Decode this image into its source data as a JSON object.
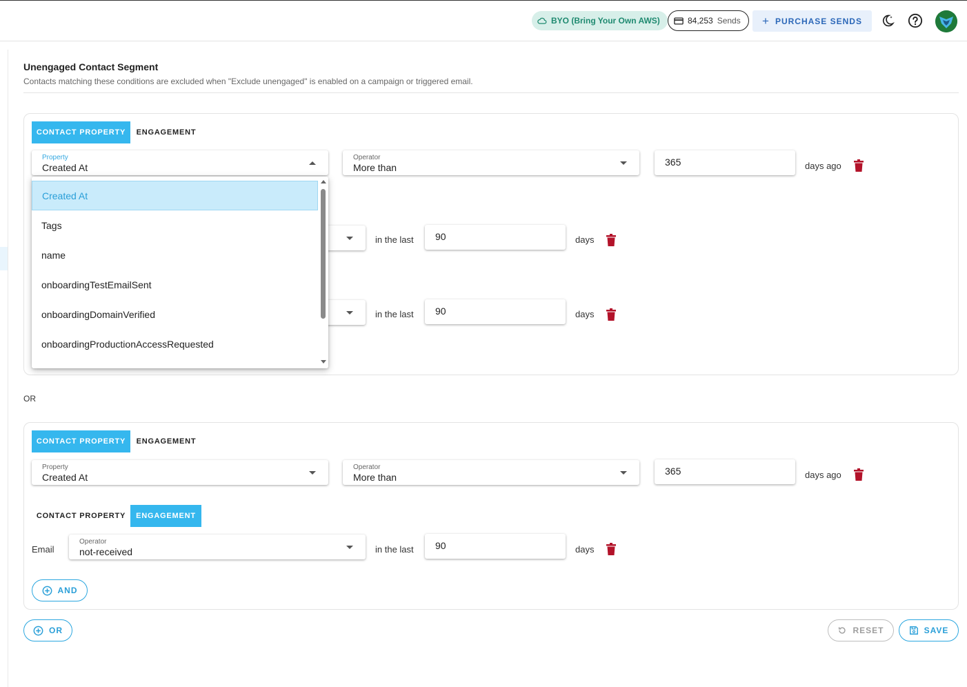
{
  "topbar": {
    "byo_label": "BYO (Bring Your Own AWS)",
    "sends_count": "84,253",
    "sends_label": "Sends",
    "purchase_label": "PURCHASE SENDS"
  },
  "header": {
    "title": "Unengaged Contact Segment",
    "subtitle": "Contacts matching these conditions are excluded when \"Exclude unengaged\" is enabled on a campaign or triggered email."
  },
  "tabs": {
    "contact_property": "CONTACT PROPERTY",
    "engagement": "ENGAGEMENT"
  },
  "group1": {
    "row1": {
      "property_label": "Property",
      "property_value": "Created At",
      "operator_label": "Operator",
      "operator_value": "More than",
      "number": "365",
      "suffix": "days ago"
    },
    "row2": {
      "connector": "in the last",
      "number": "90",
      "suffix": "days"
    },
    "row3": {
      "connector": "in the last",
      "number": "90",
      "suffix": "days"
    }
  },
  "or_label": "OR",
  "group2": {
    "row1": {
      "property_label": "Property",
      "property_value": "Created At",
      "operator_label": "Operator",
      "operator_value": "More than",
      "number": "365",
      "suffix": "days ago"
    },
    "row2": {
      "channel": "Email",
      "operator_label": "Operator",
      "operator_value": "not-received",
      "connector": "in the last",
      "number": "90",
      "suffix": "days"
    },
    "and_label": "AND"
  },
  "buttons": {
    "or": "OR",
    "reset": "RESET",
    "save": "SAVE"
  },
  "dropdown": {
    "options": [
      "Created At",
      "Tags",
      "name",
      "onboardingTestEmailSent",
      "onboardingDomainVerified",
      "onboardingProductionAccessRequested"
    ],
    "selected": "Created At"
  },
  "colors": {
    "accent": "#35b7ee",
    "danger": "#b3132a",
    "byo_bg": "#d7efe9",
    "purchase_bg": "#e8f0fb"
  }
}
